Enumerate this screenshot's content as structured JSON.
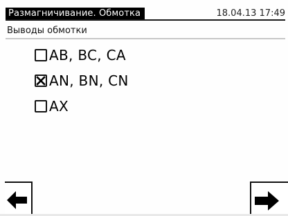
{
  "header": {
    "title": "Размагничивание. Обмотка",
    "datetime": "18.04.13 17:49"
  },
  "section": {
    "title": "Выводы обмотки"
  },
  "options": [
    {
      "label": "AB, BC, CA",
      "checked": false
    },
    {
      "label": "AN, BN, CN",
      "checked": true
    },
    {
      "label": "AX",
      "checked": false
    }
  ],
  "nav": {
    "back_icon": "arrow-left-icon",
    "next_icon": "arrow-right-icon"
  },
  "colors": {
    "foreground": "#000000",
    "background": "#ffffff",
    "header_bg": "#000000",
    "header_fg": "#ffffff"
  }
}
